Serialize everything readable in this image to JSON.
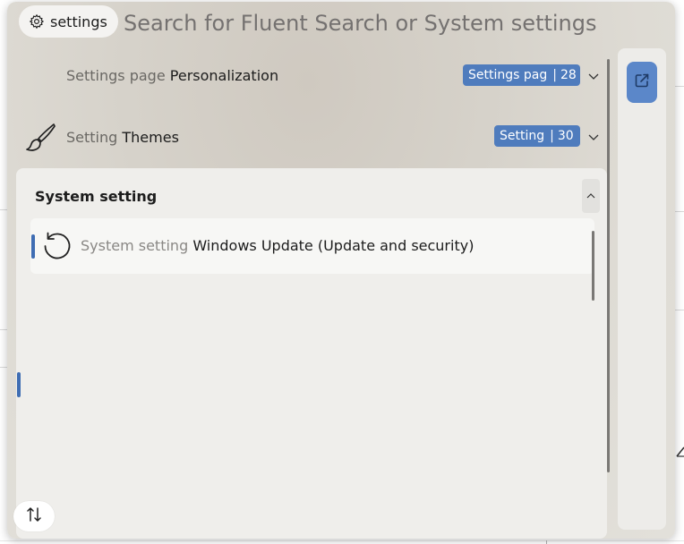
{
  "search": {
    "scope_chip": "settings",
    "placeholder": "Search for Fluent Search or System settings"
  },
  "results": [
    {
      "kind": "Settings page",
      "name": "Personalization",
      "badge_type": "Settings pag",
      "badge_count": "28",
      "icon": "none"
    },
    {
      "kind": "Setting",
      "name": "Themes",
      "badge_type": "Setting",
      "badge_count": "30",
      "icon": "paintbrush-icon"
    }
  ],
  "group": {
    "title": "System setting",
    "items": [
      {
        "kind": "System setting",
        "name": "Windows Update (Update and security)",
        "icon": "update-icon"
      }
    ]
  },
  "accent_color": "#4f7cbd",
  "icons": [
    "gear-icon",
    "chevron-down-icon",
    "chevron-up-icon",
    "open-external-icon",
    "sort-icon"
  ]
}
